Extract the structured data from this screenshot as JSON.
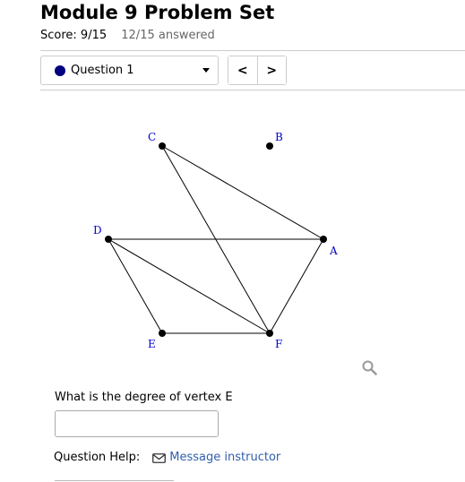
{
  "header": {
    "title": "Module 9 Problem Set",
    "score": "Score: 9/15",
    "answered": "12/15 answered"
  },
  "question_selector": {
    "selected": "Question 1",
    "status_color": "#000080"
  },
  "navigation": {
    "prev_label": "<",
    "next_label": ">"
  },
  "graph": {
    "vertices": {
      "A": "A",
      "B": "B",
      "C": "C",
      "D": "D",
      "E": "E",
      "F": "F"
    },
    "edges": [
      [
        "C",
        "F"
      ],
      [
        "C",
        "A"
      ],
      [
        "D",
        "A"
      ],
      [
        "D",
        "E"
      ],
      [
        "D",
        "F"
      ],
      [
        "E",
        "F"
      ],
      [
        "F",
        "A"
      ]
    ]
  },
  "question": {
    "text": "What is the degree of vertex E",
    "answer_value": "",
    "answer_placeholder": ""
  },
  "help": {
    "label": "Question Help:",
    "icon": "envelope-icon",
    "link_text": "Message instructor"
  },
  "colors": {
    "link": "#2f5fad",
    "vertex_label": "#0000cc"
  }
}
